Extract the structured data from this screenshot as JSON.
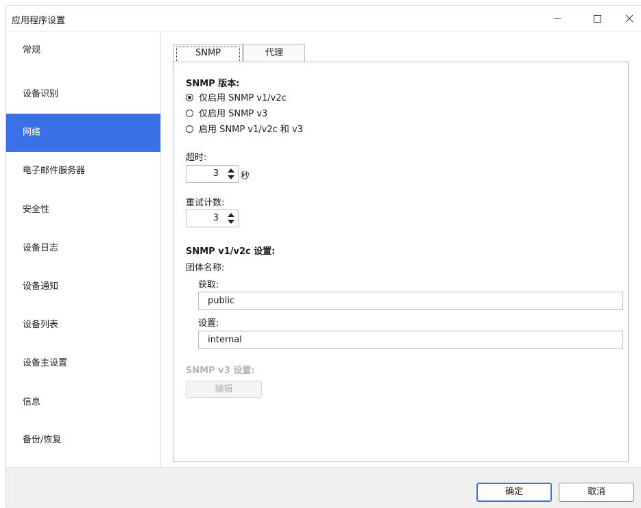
{
  "window": {
    "title": "应用程序设置"
  },
  "sidebar": {
    "items": [
      {
        "label": "常规"
      },
      {
        "label": "设备识别"
      },
      {
        "label": "网络"
      },
      {
        "label": "电子邮件服务器"
      },
      {
        "label": "安全性"
      },
      {
        "label": "设备日志"
      },
      {
        "label": "设备通知"
      },
      {
        "label": "设备列表"
      },
      {
        "label": "设备主设置"
      },
      {
        "label": "信息"
      },
      {
        "label": "备份/恢复"
      }
    ],
    "active_label": "网络"
  },
  "tabs": [
    {
      "label": "SNMP"
    },
    {
      "label": "代理"
    }
  ],
  "snmp": {
    "version_title": "SNMP 版本:",
    "version_options": [
      {
        "label": "仅启用 SNMP v1/v2c",
        "checked": true
      },
      {
        "label": "仅启用 SNMP v3",
        "checked": false
      },
      {
        "label": "启用 SNMP v1/v2c 和 v3",
        "checked": false
      }
    ],
    "timeout_label": "超时:",
    "timeout_value": "3",
    "timeout_unit": "秒",
    "retry_label": "重试计数:",
    "retry_value": "3",
    "v12_title": "SNMP v1/v2c 设置:",
    "community_label": "团体名称:",
    "get_label": "获取:",
    "get_value": "public",
    "set_label": "设置:",
    "set_value": "internal",
    "v3_title": "SNMP v3 设置:",
    "edit_label": "编辑"
  },
  "footer": {
    "ok_label": "确定",
    "cancel_label": "取消"
  },
  "colors": {
    "accent": "#3b70e6",
    "disabled_text": "#b5b5b5"
  }
}
